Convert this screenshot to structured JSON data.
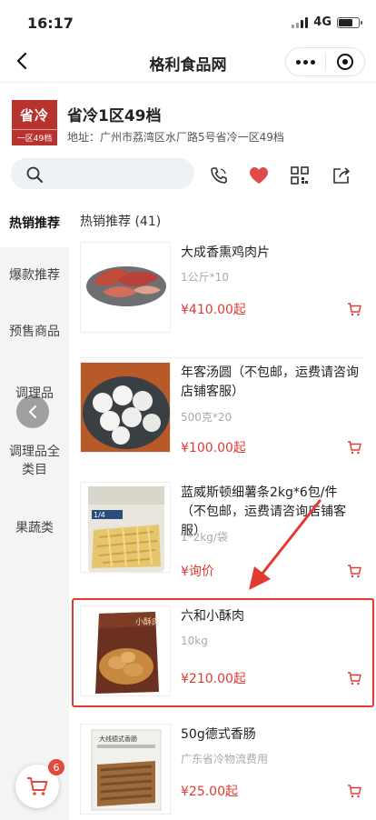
{
  "status_bar": {
    "time": "16:17",
    "network": "4G"
  },
  "nav": {
    "title": "格利食品网"
  },
  "store": {
    "logo_main": "省冷",
    "logo_sub": "一区49档",
    "name": "省冷1区49档",
    "address": "地址：广州市荔湾区水厂路5号省冷一区49档"
  },
  "search": {
    "placeholder": ""
  },
  "sidebar": {
    "items": [
      {
        "label": "热销推荐",
        "active": true
      },
      {
        "label": "爆款推荐"
      },
      {
        "label": "预售商品"
      },
      {
        "label": "调理品"
      },
      {
        "label": "调理品全类目"
      },
      {
        "label": "果蔬类"
      }
    ]
  },
  "section": {
    "title": "热销推荐 (41)"
  },
  "products": [
    {
      "name": "大成香熏鸡肉片",
      "spec": "1公斤*10",
      "price": "¥410.00起"
    },
    {
      "name": "年客汤圆（不包邮，运费请咨询店铺客服）",
      "spec": "500克*20",
      "price": "¥100.00起"
    },
    {
      "name": "蓝威斯顿细薯条2kg*6包/件（不包邮，运费请咨询店铺客服）",
      "spec": "1*2kg/袋",
      "price": "¥询价",
      "image_label": "1/4"
    },
    {
      "name": "六和小酥肉",
      "spec": "10kg",
      "price": "¥210.00起",
      "image_label": "小酥肉"
    },
    {
      "name": "50g德式香肠",
      "spec": "广东省冷物流费用",
      "price": "¥25.00起",
      "image_label": "大线德式香肠"
    }
  ],
  "cart": {
    "badge": "6"
  },
  "colors": {
    "accent": "#e03a32",
    "brand": "#b8332d",
    "highlight": "#e23a2f"
  }
}
